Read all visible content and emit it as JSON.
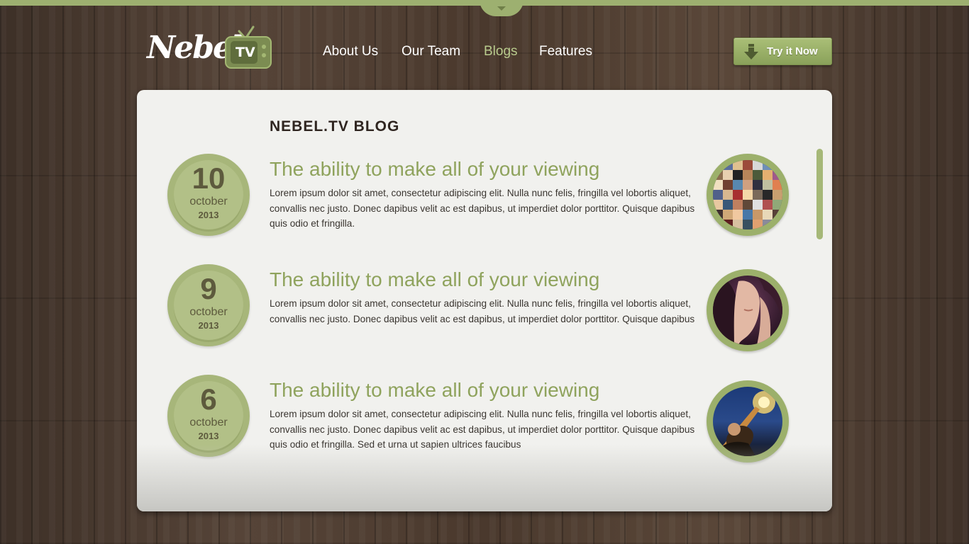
{
  "header": {
    "logo_text": "Nebel.",
    "logo_tv": "TV",
    "nav": [
      {
        "label": "About Us",
        "active": false
      },
      {
        "label": "Our Team",
        "active": false
      },
      {
        "label": "Blogs",
        "active": true
      },
      {
        "label": "Features",
        "active": false
      }
    ],
    "cta_label": "Try it Now"
  },
  "blog": {
    "heading": "NEBEL.TV BLOG",
    "posts": [
      {
        "day": "10",
        "month": "october",
        "year": "2013",
        "title": "The ability to make all of your viewing",
        "body": "Lorem ipsum dolor sit amet, consectetur adipiscing elit. Nulla nunc felis, fringilla vel lobortis aliquet, convallis nec justo. Donec dapibus velit ac est dapibus, ut imperdiet dolor porttitor. Quisque dapibus quis odio et fringilla.",
        "image": "photo-mosaic-collage"
      },
      {
        "day": "9",
        "month": "october",
        "year": "2013",
        "title": "The ability to make all of your viewing",
        "body": "Lorem ipsum dolor sit amet, consectetur adipiscing elit. Nulla nunc felis, fringilla vel lobortis aliquet, convallis nec justo. Donec dapibus velit ac est dapibus, ut imperdiet dolor porttitor. Quisque dapibus",
        "image": "woman-portrait-photo"
      },
      {
        "day": "6",
        "month": "october",
        "year": "2013",
        "title": "The ability to make all of your viewing",
        "body": "Lorem ipsum dolor sit amet, consectetur adipiscing elit. Nulla nunc felis, fringilla vel lobortis aliquet, convallis nec justo. Donec dapibus velit ac est dapibus, ut imperdiet dolor porttitor. Quisque dapibus quis odio et fringilla. Sed et urna ut sapien ultrices faucibus",
        "image": "guitarist-concert-photo"
      }
    ]
  },
  "colors": {
    "accent_green": "#9db070",
    "title_green": "#8fa35d",
    "active_nav": "#b9cb8d",
    "panel_bg": "#f1f1ee",
    "wood_bg": "#4a3a2e"
  }
}
